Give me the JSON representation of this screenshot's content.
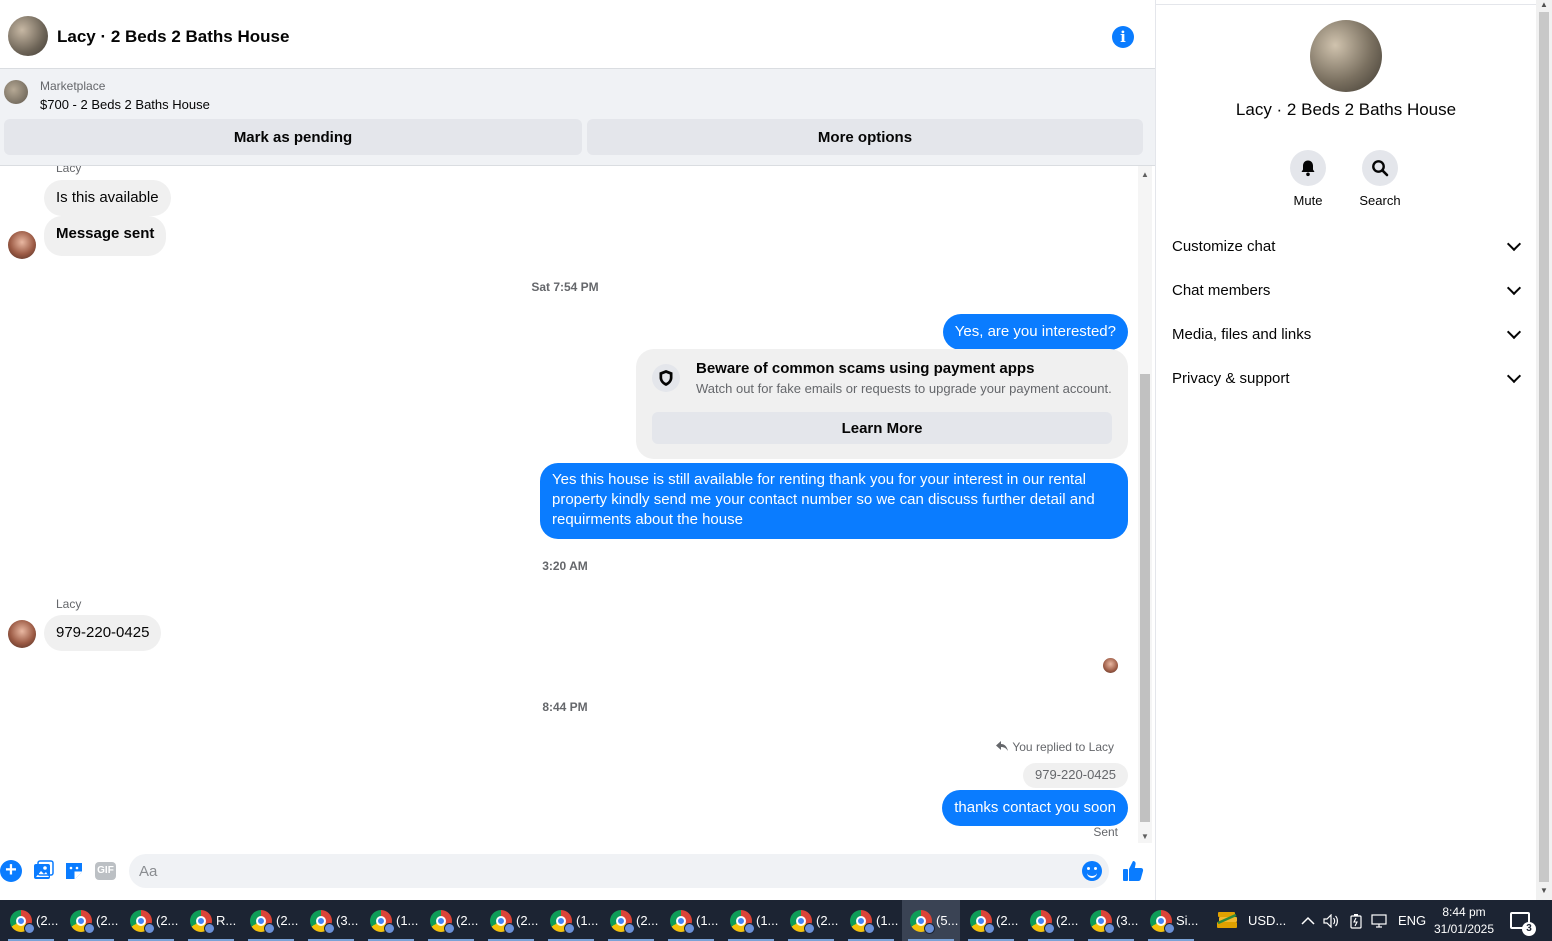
{
  "header": {
    "title": "Lacy · 2 Beds 2 Baths House",
    "info_icon": "info-icon"
  },
  "listing": {
    "kind": "Marketplace",
    "price_title": "$700 - 2 Beds 2 Baths House",
    "mark_pending": "Mark as pending",
    "more_options": "More options"
  },
  "messages": {
    "sender_1": "Lacy",
    "in_1": "Is this available",
    "in_2": "Message sent",
    "stamp_1": "Sat 7:54 PM",
    "out_1": "Yes, are you interested?",
    "scam": {
      "title": "Beware of common scams using payment apps",
      "subtitle": "Watch out for fake emails or requests to upgrade your payment account.",
      "button": "Learn More"
    },
    "out_2": "Yes this house is still available for renting thank you for your interest in our rental property kindly send me your contact number so we can discuss further detail and requirments about the house",
    "stamp_2": "3:20 AM",
    "sender_2": "Lacy",
    "in_3": "979-220-0425",
    "stamp_3": "8:44 PM",
    "reply_label": "You replied to Lacy",
    "reply_quote": "979-220-0425",
    "out_3": "thanks contact you soon",
    "sent": "Sent"
  },
  "composer": {
    "placeholder": "Aa",
    "gif_label": "GIF"
  },
  "details": {
    "name": "Lacy · 2 Beds 2 Baths House",
    "actions": [
      {
        "label": "Mute",
        "icon": "bell-icon"
      },
      {
        "label": "Search",
        "icon": "search-icon"
      }
    ],
    "sections": [
      "Customize chat",
      "Chat members",
      "Media, files and links",
      "Privacy & support"
    ]
  },
  "taskbar": {
    "items": [
      "(2...",
      "(2...",
      "(2...",
      "R...",
      "(2...",
      "(3...",
      "(1...",
      "(2...",
      "(2...",
      "(1...",
      "(2...",
      "(1...",
      "(1...",
      "(2...",
      "(1...",
      "(5...",
      "(2...",
      "(2...",
      "(3...",
      "Si..."
    ],
    "active_index": 15,
    "currency": "USD...",
    "language": "ENG",
    "time": "8:44 pm",
    "date": "31/01/2025",
    "notification_count": "3"
  },
  "colors": {
    "accent": "#0a7cff",
    "incoming_bubble": "#f0f0f0",
    "taskbar": "#1c2433"
  }
}
